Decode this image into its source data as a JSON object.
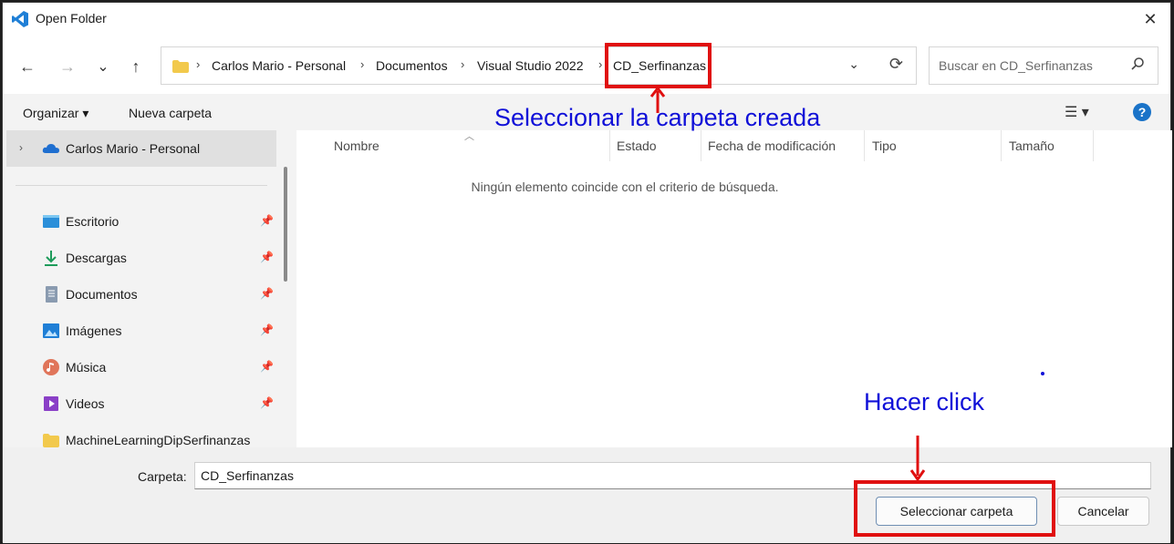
{
  "window": {
    "title": "Open Folder",
    "close_label": "✕"
  },
  "nav": {
    "back": "←",
    "forward": "→",
    "recent": "⌄",
    "up": "↑",
    "breadcrumbs": [
      "Carlos Mario - Personal",
      "Documentos",
      "Visual Studio 2022",
      "CD_Serfinanzas"
    ],
    "breadcrumb_sep": "›",
    "dropdown": "⌄",
    "refresh": "⟳",
    "search_placeholder": "Buscar en CD_Serfinanzas"
  },
  "toolbar": {
    "organize": "Organizar ▾",
    "new_folder": "Nueva carpeta",
    "view": "☰ ▾",
    "help": "?"
  },
  "sidebar": {
    "root": {
      "label": "Carlos Mario - Personal",
      "chevron": "›"
    },
    "items": [
      {
        "label": "Escritorio",
        "icon": "desktop-icon",
        "pinned": true
      },
      {
        "label": "Descargas",
        "icon": "download-icon",
        "pinned": true
      },
      {
        "label": "Documentos",
        "icon": "document-icon",
        "pinned": true
      },
      {
        "label": "Imágenes",
        "icon": "pictures-icon",
        "pinned": true
      },
      {
        "label": "Música",
        "icon": "music-icon",
        "pinned": true
      },
      {
        "label": "Videos",
        "icon": "video-icon",
        "pinned": true
      },
      {
        "label": "MachineLearningDipSerfinanzas",
        "icon": "folder-icon",
        "pinned": false
      }
    ],
    "pin_glyph": "📌"
  },
  "files": {
    "columns": [
      "Nombre",
      "Estado",
      "Fecha de modificación",
      "Tipo",
      "Tamaño"
    ],
    "sort_glyph": "︿",
    "empty_message": "Ningún elemento coincide con el criterio de búsqueda."
  },
  "footer": {
    "folder_label": "Carpeta:",
    "folder_value": "CD_Serfinanzas",
    "select_button": "Seleccionar carpeta",
    "cancel_button": "Cancelar"
  },
  "annotations": {
    "top_text": "Seleccionar la carpeta creada",
    "bottom_text": "Hacer click",
    "color_box": "#e01010",
    "color_text": "#1010d8"
  }
}
